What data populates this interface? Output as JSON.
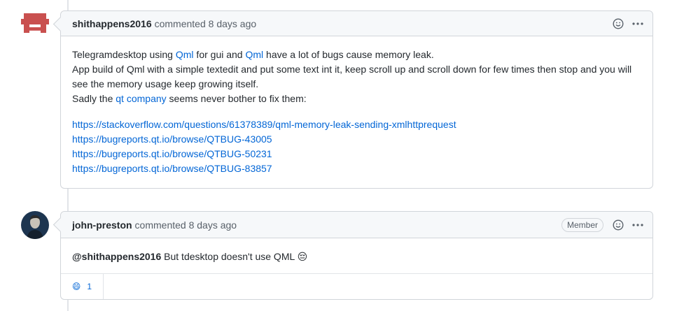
{
  "comments": [
    {
      "author": "shithappens2016",
      "meta": "commented 8 days ago",
      "body": {
        "line1": {
          "t1": "Telegramdesktop using ",
          "link1": "Qml",
          "t2": " for gui and ",
          "link2": "Qml",
          "t3": " have a lot of bugs cause memory leak."
        },
        "line2": "App build of Qml with a simple textedit and put some text int it, keep scroll up and scroll down for few times then stop and you will see the memory usage keep growing itself.",
        "line3": {
          "t1": "Sadly the ",
          "link": "qt company",
          "t2": " seems never bother to fix them:"
        },
        "links": [
          "https://stackoverflow.com/questions/61378389/qml-memory-leak-sending-xmlhttprequest",
          "https://bugreports.qt.io/browse/QTBUG-43005",
          "https://bugreports.qt.io/browse/QTBUG-50231",
          "https://bugreports.qt.io/browse/QTBUG-83857"
        ]
      }
    },
    {
      "author": "john-preston",
      "meta": "commented 8 days ago",
      "badge": "Member",
      "mention": "@shithappens2016",
      "text": " But tdesktop doesn't use QML ",
      "emoji": "😔",
      "reaction": {
        "emoji": "😄",
        "count": "1"
      }
    }
  ],
  "icons": {
    "emoji_picker": "smiley-icon",
    "more": "kebab-icon",
    "avatar1": "identicon-avatar"
  },
  "colors": {
    "link": "#0366d6",
    "header_bg": "#f6f8fa",
    "border": "#d1d5da",
    "identicon": "#c9504f"
  }
}
